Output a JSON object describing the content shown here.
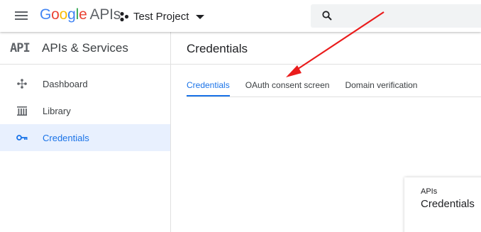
{
  "topbar": {
    "logo_google": "Google",
    "logo_apis": "APIs",
    "project_name": "Test Project",
    "search_placeholder": ""
  },
  "sidebar": {
    "badge": "API",
    "title": "APIs & Services",
    "items": [
      {
        "label": "Dashboard",
        "icon": "dashboard-icon"
      },
      {
        "label": "Library",
        "icon": "library-icon"
      },
      {
        "label": "Credentials",
        "icon": "key-icon",
        "active": true
      }
    ]
  },
  "main": {
    "title": "Credentials",
    "tabs": [
      {
        "label": "Credentials",
        "active": true
      },
      {
        "label": "OAuth consent screen"
      },
      {
        "label": "Domain verification"
      }
    ],
    "card": {
      "subtitle": "APIs",
      "title": "Credentials"
    }
  },
  "annotation": {
    "color": "#ea1c1c",
    "type": "arrow"
  },
  "colors": {
    "accent": "#1a73e8",
    "active_bg": "#e8f0fe"
  }
}
